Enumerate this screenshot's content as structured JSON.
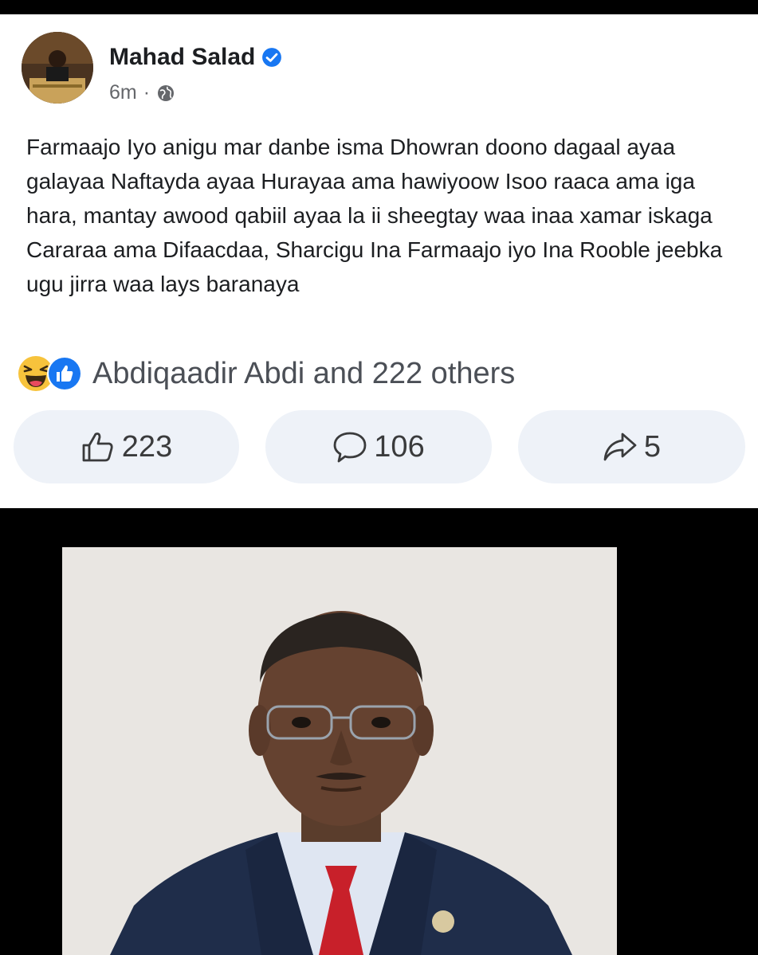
{
  "post": {
    "author": "Mahad Salad",
    "time": "6m",
    "separator": "·",
    "text": "Farmaajo Iyo anigu mar danbe isma Dhowran doono dagaal ayaa galayaa Naftayda ayaa Hurayaa ama hawiyoow  Isoo raaca ama iga hara, mantay awood qabiil ayaa la ii sheegtay waa inaa xamar iskaga Cararaa ama Difaacdaa, Sharcigu Ina Farmaajo iyo Ina Rooble jeebka ugu jirra waa lays baranaya",
    "reaction_icons": [
      "haha-emoji-icon",
      "like-reaction-icon"
    ],
    "reactions_summary": "Abdiqaadir Abdi and 222 others",
    "actions": {
      "like_count": "223",
      "comment_count": "106",
      "share_count": "5"
    }
  },
  "icons": {
    "verified": "verified-badge-icon",
    "audience": "globe-icon",
    "like": "thumbs-up-icon",
    "comment": "speech-bubble-icon",
    "share": "share-arrow-icon"
  },
  "colors": {
    "verified_blue": "#1877f2",
    "pill_bg": "#eef2f8",
    "text_primary": "#1c1e21",
    "text_secondary": "#65676b"
  }
}
